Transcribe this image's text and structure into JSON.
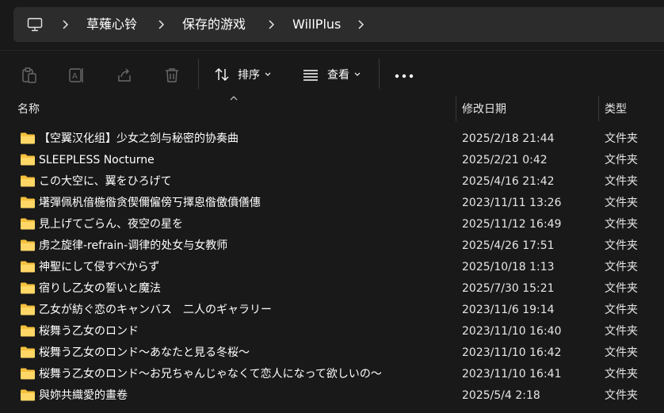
{
  "breadcrumb": {
    "items": [
      "草薙心铃",
      "保存的游戏",
      "WillPlus"
    ]
  },
  "toolbar": {
    "sort_label": "排序",
    "view_label": "查看"
  },
  "columns": {
    "name": "名称",
    "modified": "修改日期",
    "type": "类型"
  },
  "colors": {
    "folder": "#f5c13d",
    "background": "#191919",
    "addressbar": "#2c2c2c"
  },
  "files": [
    {
      "name": "【空翼汉化组】少女之剑与秘密的协奏曲",
      "modified": "2025/2/18 21:44",
      "type": "文件夹"
    },
    {
      "name": "SLEEPLESS Nocturne",
      "modified": "2025/2/21 0:42",
      "type": "文件夹"
    },
    {
      "name": "この大空に、翼をひろげて",
      "modified": "2025/4/16 21:42",
      "type": "文件夹"
    },
    {
      "name": "墸彈佩杋偣椸偺贪偰儞僱傍丂擇恖偺儌僨僐僡",
      "modified": "2023/11/11 13:26",
      "type": "文件夹"
    },
    {
      "name": "見上げてごらん、夜空の星を",
      "modified": "2025/11/12 16:49",
      "type": "文件夹"
    },
    {
      "name": "虏之旋律-refrain-调律的处女与女教师",
      "modified": "2025/4/26 17:51",
      "type": "文件夹"
    },
    {
      "name": "神聖にして侵すべからず",
      "modified": "2025/10/18 1:13",
      "type": "文件夹"
    },
    {
      "name": "宿りし乙女の誓いと魔法",
      "modified": "2025/7/30 15:21",
      "type": "文件夹"
    },
    {
      "name": "乙女が紡ぐ恋のキャンバス　二人のギャラリー",
      "modified": "2023/11/6 19:14",
      "type": "文件夹"
    },
    {
      "name": "桜舞う乙女のロンド",
      "modified": "2023/11/10 16:40",
      "type": "文件夹"
    },
    {
      "name": "桜舞う乙女のロンド～あなたと見る冬桜～",
      "modified": "2023/11/10 16:42",
      "type": "文件夹"
    },
    {
      "name": "桜舞う乙女のロンド～お兄ちゃんじゃなくて恋人になって欲しいの～",
      "modified": "2023/11/10 16:41",
      "type": "文件夹"
    },
    {
      "name": "與妳共織愛的畫卷",
      "modified": "2025/5/4 2:18",
      "type": "文件夹"
    }
  ]
}
